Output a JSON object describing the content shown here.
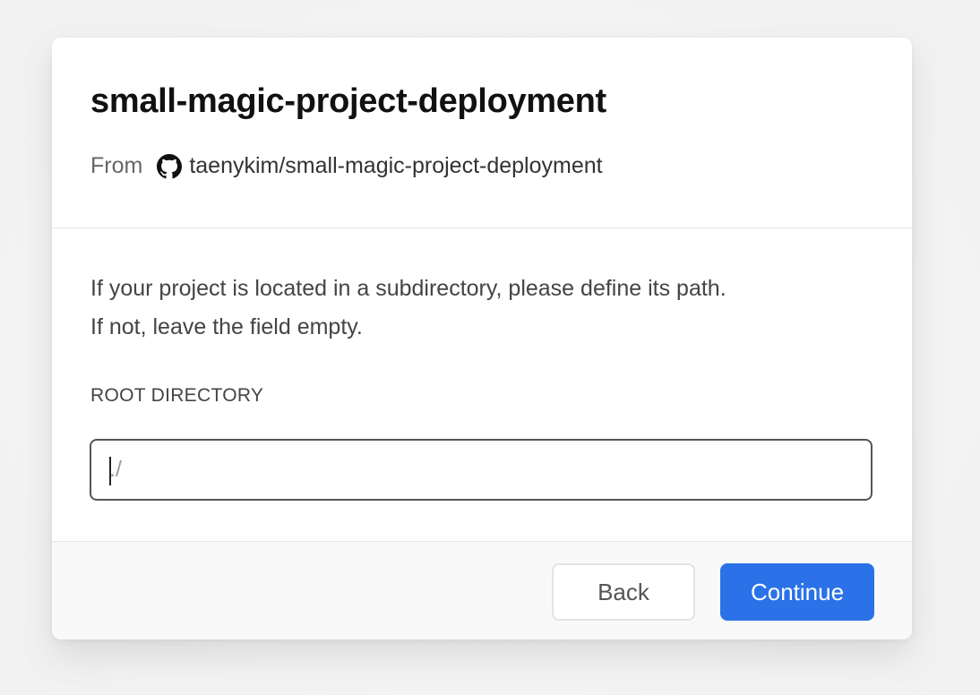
{
  "modal": {
    "title": "small-magic-project-deployment",
    "from_label": "From",
    "repo_icon": "github-icon",
    "repo_name": "taenykim/small-magic-project-deployment"
  },
  "body": {
    "description_line1": "If your project is located in a subdirectory, please define its path.",
    "description_line2": "If not, leave the field empty.",
    "field_label": "ROOT DIRECTORY",
    "input_placeholder": "./",
    "input_value": ""
  },
  "footer": {
    "back_label": "Back",
    "continue_label": "Continue"
  },
  "colors": {
    "primary": "#2b72e8",
    "text_dark": "#111111",
    "text_muted": "#666666"
  }
}
